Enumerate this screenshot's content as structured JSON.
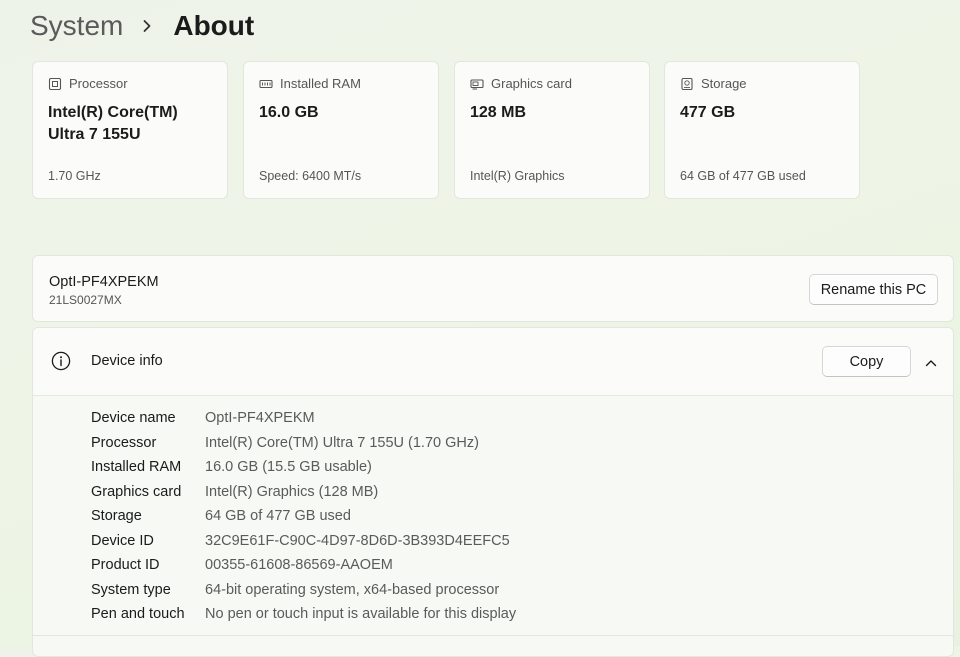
{
  "breadcrumb": {
    "parent": "System",
    "current": "About"
  },
  "spec_cards": [
    {
      "label": "Processor",
      "icon": "processor-icon",
      "value": "Intel(R) Core(TM) Ultra 7 155U",
      "sub": "1.70 GHz"
    },
    {
      "label": "Installed RAM",
      "icon": "ram-icon",
      "value": "16.0 GB",
      "sub": "Speed: 6400 MT/s"
    },
    {
      "label": "Graphics card",
      "icon": "graphics-card-icon",
      "value": "128 MB",
      "sub": "Intel(R) Graphics"
    },
    {
      "label": "Storage",
      "icon": "storage-icon",
      "value": "477 GB",
      "sub": "64 GB of 477 GB used"
    }
  ],
  "pc": {
    "name": "OptI-PF4XPEKM",
    "model": "21LS0027MX",
    "rename_label": "Rename this PC"
  },
  "device_info": {
    "title": "Device info",
    "copy_label": "Copy",
    "specs": [
      {
        "label": "Device name",
        "value": "OptI-PF4XPEKM"
      },
      {
        "label": "Processor",
        "value": "Intel(R) Core(TM) Ultra 7 155U (1.70 GHz)"
      },
      {
        "label": "Installed RAM",
        "value": "16.0 GB (15.5 GB usable)"
      },
      {
        "label": "Graphics card",
        "value": "Intel(R) Graphics (128 MB)"
      },
      {
        "label": "Storage",
        "value": "64 GB of 477 GB used"
      },
      {
        "label": "Device ID",
        "value": "32C9E61F-C90C-4D97-8D6D-3B393D4EEFC5"
      },
      {
        "label": "Product ID",
        "value": "00355-61608-86569-AAOEM"
      },
      {
        "label": "System type",
        "value": "64-bit operating system, x64-based processor"
      },
      {
        "label": "Pen and touch",
        "value": "No pen or touch input is available for this display"
      }
    ]
  },
  "colors": {
    "background": "#eef4e8",
    "card": "#fbfcfa",
    "border": "#e2e6de"
  }
}
